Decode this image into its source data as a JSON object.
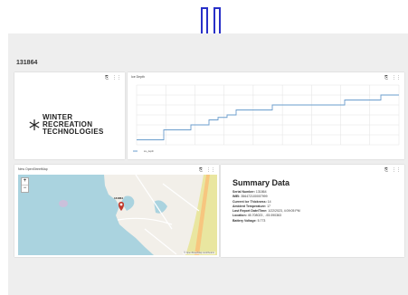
{
  "dashboard": {
    "name": "131864"
  },
  "icons": {
    "export": "export-icon",
    "more": "more-icon"
  },
  "logo_card": {
    "logo_text_line1": "WINTER RECREATION",
    "logo_text_line2": "TECHNOLOGIES"
  },
  "chart_card": {
    "title": "Ice Depth",
    "chart_data": {
      "type": "line",
      "title": "",
      "series": [
        {
          "name": "ice_depth",
          "color": "#6a9dcc",
          "values": [
            3,
            3,
            3,
            5,
            5,
            5,
            6,
            6,
            7,
            7.5,
            8,
            9,
            9,
            9,
            9,
            10,
            10,
            10,
            10,
            10,
            10,
            10,
            10,
            11,
            11,
            11,
            11,
            12,
            12,
            12
          ]
        }
      ],
      "ylim": [
        2,
        14
      ],
      "y_ticks": [
        "",
        "",
        "",
        "",
        "",
        "",
        ""
      ],
      "x_ticks": [
        "",
        "",
        "",
        "",
        "",
        "",
        "",
        "",
        "",
        ""
      ],
      "grid": true
    },
    "legend_label": "ice_depth"
  },
  "map_card": {
    "title": "New OpenStreetMap",
    "zoom_in": "+",
    "zoom_out": "−",
    "marker_label": "131864",
    "attribution": "© OpenStreetMap contributors"
  },
  "summary_card": {
    "title": "Summary Data",
    "rows": [
      {
        "label": "Serial Number:",
        "value": "131864"
      },
      {
        "label": "IMEI:",
        "value": "356472100007999"
      },
      {
        "label": "Current Ice Thickness:",
        "value": "14"
      },
      {
        "label": "Ambient Temperature:",
        "value": "17"
      },
      {
        "label": "Last Report Date/Time:",
        "value": "1/22/2023, 4:09:05 PM"
      },
      {
        "label": "Location:",
        "value": "45.708023 , -93.090363"
      },
      {
        "label": "Battery Voltage:",
        "value": "5.773"
      }
    ]
  }
}
